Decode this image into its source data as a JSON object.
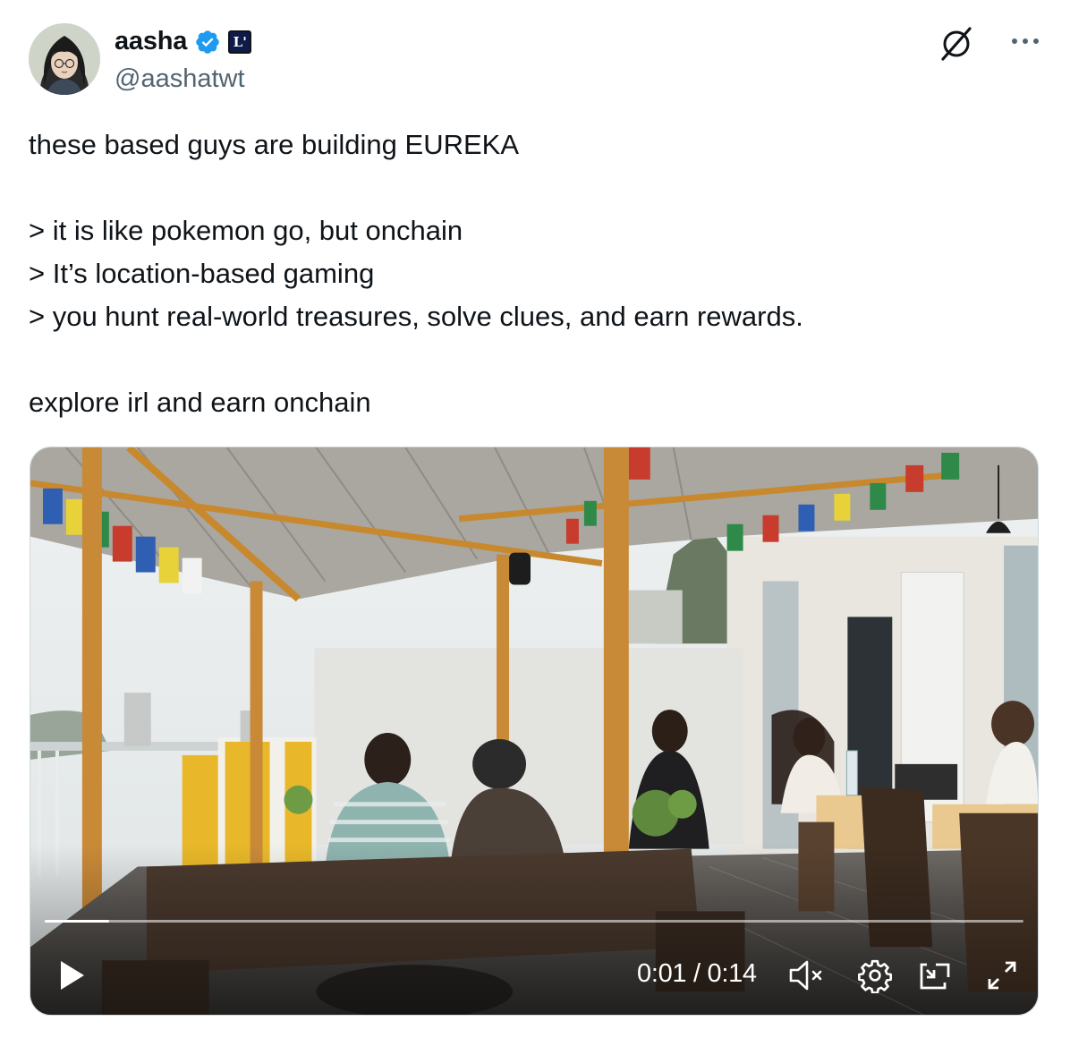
{
  "author": {
    "display_name": "aasha",
    "handle": "@aashatwt",
    "affiliate_badge": "L'"
  },
  "tweet": {
    "lines": [
      "these based guys are building EUREKA",
      "",
      "> it is like pokemon go, but onchain",
      "> It’s location-based gaming",
      "> you hunt real-world treasures, solve clues, and earn rewards.",
      "",
      "explore irl and earn onchain"
    ]
  },
  "video": {
    "current_time": "0:01",
    "duration": "0:14",
    "time_label": "0:01 / 0:14",
    "progress": 0.066,
    "muted": true
  },
  "icons": {
    "verified": "verified-badge-icon",
    "grok": "grok-icon",
    "more": "more-icon",
    "play": "play-icon",
    "mute": "volume-muted-icon",
    "settings": "settings-gear-icon",
    "pip": "picture-in-picture-icon",
    "fullscreen": "fullscreen-icon"
  },
  "colors": {
    "verified_blue": "#1d9bf0",
    "text_primary": "#0f1419",
    "text_secondary": "#536471"
  }
}
